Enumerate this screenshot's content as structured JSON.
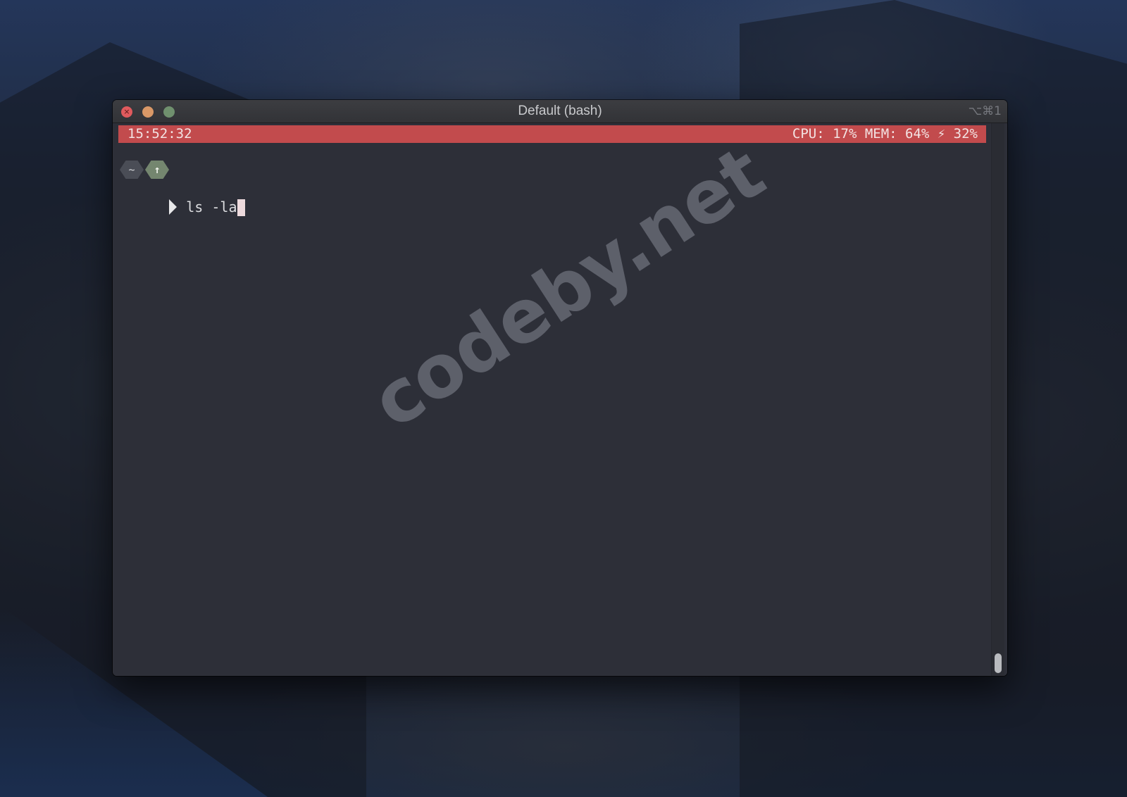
{
  "window": {
    "title": "Default (bash)",
    "shortcut": "⌥⌘1",
    "controls": {
      "close": "×",
      "minimize": "",
      "maximize": ""
    }
  },
  "statusbar": {
    "time": "15:52:32",
    "stats": "CPU: 17% MEM: 64% ⚡ 32%"
  },
  "prompt": {
    "home_badge": "~",
    "git_badge": "↑",
    "command": "ls -la"
  },
  "watermark": "codeby.net",
  "colors": {
    "statusbar": "#c24b4d",
    "terminal_bg": "#2d2f38",
    "git_badge": "#74866f"
  }
}
